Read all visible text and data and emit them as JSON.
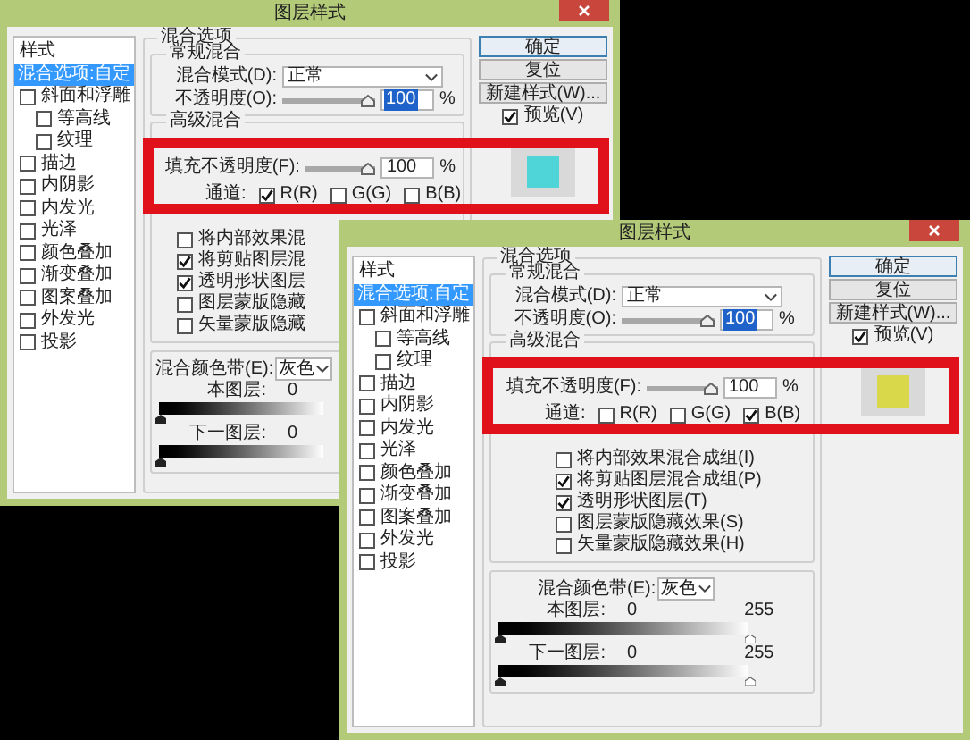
{
  "windows": [
    {
      "title": "图层样式",
      "sidebar": {
        "header": "样式",
        "items": [
          {
            "label": "混合选项:自定",
            "kind": "option",
            "selected": true
          },
          {
            "label": "斜面和浮雕",
            "kind": "checkbox",
            "selected": false,
            "checked": false,
            "children": [
              {
                "label": "等高线",
                "kind": "checkbox",
                "selected": false,
                "checked": false
              },
              {
                "label": "纹理",
                "kind": "checkbox",
                "selected": false,
                "checked": false
              }
            ]
          },
          {
            "label": "描边",
            "kind": "checkbox",
            "selected": false,
            "checked": false
          },
          {
            "label": "内阴影",
            "kind": "checkbox",
            "selected": false,
            "checked": false
          },
          {
            "label": "内发光",
            "kind": "checkbox",
            "selected": false,
            "checked": false
          },
          {
            "label": "光泽",
            "kind": "checkbox",
            "selected": false,
            "checked": false
          },
          {
            "label": "颜色叠加",
            "kind": "checkbox",
            "selected": false,
            "checked": false
          },
          {
            "label": "渐变叠加",
            "kind": "checkbox",
            "selected": false,
            "checked": false
          },
          {
            "label": "图案叠加",
            "kind": "checkbox",
            "selected": false,
            "checked": false
          },
          {
            "label": "外发光",
            "kind": "checkbox",
            "selected": false,
            "checked": false
          },
          {
            "label": "投影",
            "kind": "checkbox",
            "selected": false,
            "checked": false
          }
        ]
      },
      "blending": {
        "title": "混合选项",
        "general": {
          "title": "常规混合",
          "mode_label": "混合模式(D):",
          "mode_value": "正常",
          "opacity_label": "不透明度(O):",
          "opacity": {
            "level": 1,
            "value": "100",
            "percent": "%"
          }
        },
        "advanced": {
          "title": "高级混合",
          "fill_label": "填充不透明度(F):",
          "fill": {
            "level": 1,
            "value": "100",
            "percent": "%"
          },
          "channels_label": "通道:",
          "channels": [
            {
              "label": "R(R)",
              "checked": true
            },
            {
              "label": "G(G)",
              "checked": false
            },
            {
              "label": "B(B)",
              "checked": false
            }
          ],
          "options": [
            {
              "label": "将内部效果混",
              "checked": false
            },
            {
              "label": "将剪贴图层混",
              "checked": true
            },
            {
              "label": "透明形状图层",
              "checked": true
            },
            {
              "label": "图层蒙版隐藏",
              "checked": false
            },
            {
              "label": "矢量蒙版隐藏",
              "checked": false
            }
          ]
        },
        "blend_if": {
          "label": "混合颜色带(E):",
          "value": "灰色",
          "layers": [
            {
              "label": "本图层:",
              "low": "0"
            },
            {
              "label": "下一图层:",
              "low": "0"
            }
          ]
        }
      },
      "buttons": [
        {
          "label": "确定",
          "default": true
        },
        {
          "label": "复位",
          "default": false
        },
        {
          "label": "新建样式(W)...",
          "default": false
        }
      ],
      "preview": {
        "label": "预览(V)",
        "checked": true,
        "color": "#4fd4d8"
      }
    },
    {
      "title": "图层样式",
      "sidebar": {
        "header": "样式",
        "items": [
          {
            "label": "混合选项:自定",
            "kind": "option",
            "selected": true
          },
          {
            "label": "斜面和浮雕",
            "kind": "checkbox",
            "selected": false,
            "checked": false,
            "children": [
              {
                "label": "等高线",
                "kind": "checkbox",
                "selected": false,
                "checked": false
              },
              {
                "label": "纹理",
                "kind": "checkbox",
                "selected": false,
                "checked": false
              }
            ]
          },
          {
            "label": "描边",
            "kind": "checkbox",
            "selected": false,
            "checked": false
          },
          {
            "label": "内阴影",
            "kind": "checkbox",
            "selected": false,
            "checked": false
          },
          {
            "label": "内发光",
            "kind": "checkbox",
            "selected": false,
            "checked": false
          },
          {
            "label": "光泽",
            "kind": "checkbox",
            "selected": false,
            "checked": false
          },
          {
            "label": "颜色叠加",
            "kind": "checkbox",
            "selected": false,
            "checked": false
          },
          {
            "label": "渐变叠加",
            "kind": "checkbox",
            "selected": false,
            "checked": false
          },
          {
            "label": "图案叠加",
            "kind": "checkbox",
            "selected": false,
            "checked": false
          },
          {
            "label": "外发光",
            "kind": "checkbox",
            "selected": false,
            "checked": false
          },
          {
            "label": "投影",
            "kind": "checkbox",
            "selected": false,
            "checked": false
          }
        ]
      },
      "blending": {
        "title": "混合选项",
        "general": {
          "title": "常规混合",
          "mode_label": "混合模式(D):",
          "mode_value": "正常",
          "opacity_label": "不透明度(O):",
          "opacity": {
            "level": 1,
            "value": "100",
            "percent": "%"
          }
        },
        "advanced": {
          "title": "高级混合",
          "fill_label": "填充不透明度(F):",
          "fill": {
            "level": 1,
            "value": "100",
            "percent": "%"
          },
          "channels_label": "通道:",
          "channels": [
            {
              "label": "R(R)",
              "checked": false
            },
            {
              "label": "G(G)",
              "checked": false
            },
            {
              "label": "B(B)",
              "checked": true
            }
          ],
          "options": [
            {
              "label": "将内部效果混合成组(I)",
              "checked": false
            },
            {
              "label": "将剪贴图层混合成组(P)",
              "checked": true
            },
            {
              "label": "透明形状图层(T)",
              "checked": true
            },
            {
              "label": "图层蒙版隐藏效果(S)",
              "checked": false
            },
            {
              "label": "矢量蒙版隐藏效果(H)",
              "checked": false
            }
          ]
        },
        "blend_if": {
          "label": "混合颜色带(E):",
          "value": "灰色",
          "layers": [
            {
              "label": "本图层:",
              "low": "0",
              "high": "255"
            },
            {
              "label": "下一图层:",
              "low": "0",
              "high": "255"
            }
          ]
        }
      },
      "buttons": [
        {
          "label": "确定",
          "default": true
        },
        {
          "label": "复位",
          "default": false
        },
        {
          "label": "新建样式(W)...",
          "default": false
        }
      ],
      "preview": {
        "label": "预览(V)",
        "checked": true,
        "color": "#d8d84a"
      }
    }
  ]
}
